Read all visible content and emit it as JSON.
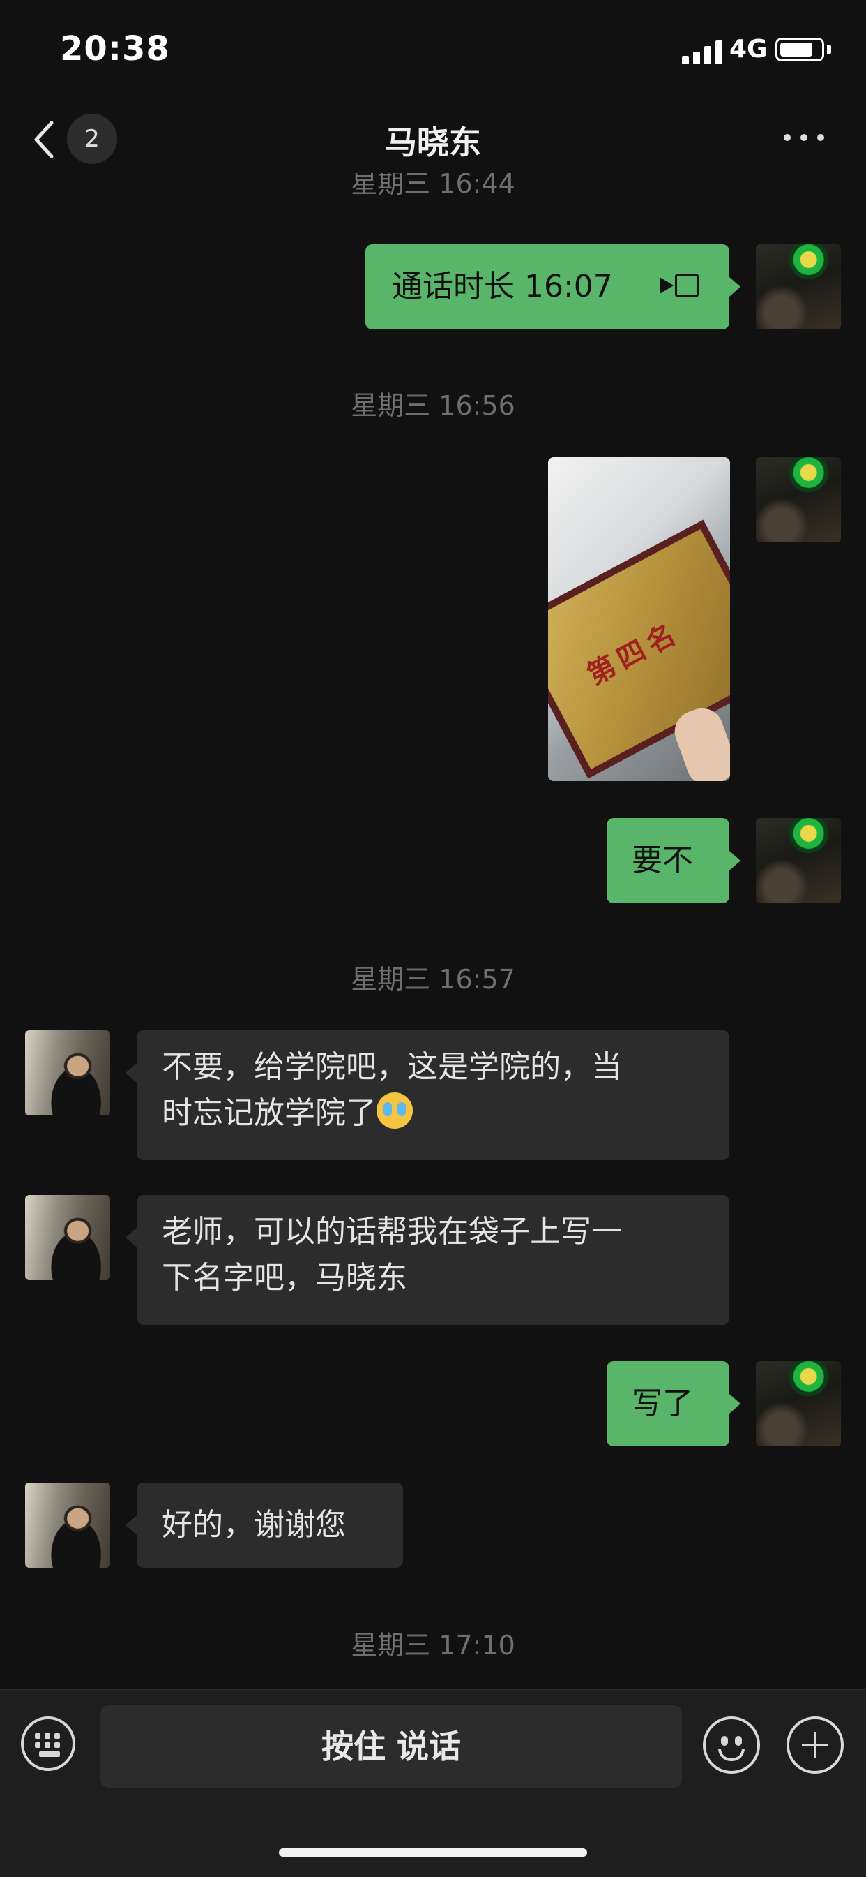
{
  "status_bar": {
    "time": "20:38",
    "network": "4G",
    "battery_level": 0.75
  },
  "nav": {
    "back_label": "back",
    "unread_badge": "2",
    "title": "马晓东"
  },
  "messages": [
    {
      "type": "timestamp",
      "text": "星期三 16:44"
    },
    {
      "type": "call",
      "from": "me",
      "text": "通话时长 16:07",
      "icon": "video-call-icon"
    },
    {
      "type": "timestamp",
      "text": "星期三 16:56"
    },
    {
      "type": "image",
      "from": "me",
      "caption_on_image": "第四名"
    },
    {
      "type": "text",
      "from": "me",
      "text": "要不"
    },
    {
      "type": "timestamp",
      "text": "星期三 16:57"
    },
    {
      "type": "text",
      "from": "other",
      "line1": "不要，给学院吧，这是学院的，当",
      "line2": "时忘记放学院了",
      "emoji": "crying-laughing-emoji"
    },
    {
      "type": "text",
      "from": "other",
      "line1": "老师，可以的话帮我在袋子上写一",
      "line2": "下名字吧，马晓东"
    },
    {
      "type": "text",
      "from": "me",
      "text": "写了"
    },
    {
      "type": "text",
      "from": "other",
      "text": "好的，谢谢您"
    },
    {
      "type": "timestamp",
      "text": "星期三 17:10"
    }
  ],
  "input_bar": {
    "talk_label": "按住 说话"
  },
  "colors": {
    "my_bubble": "#59b56a",
    "other_bubble": "#2c2c2c",
    "background": "#111111"
  }
}
